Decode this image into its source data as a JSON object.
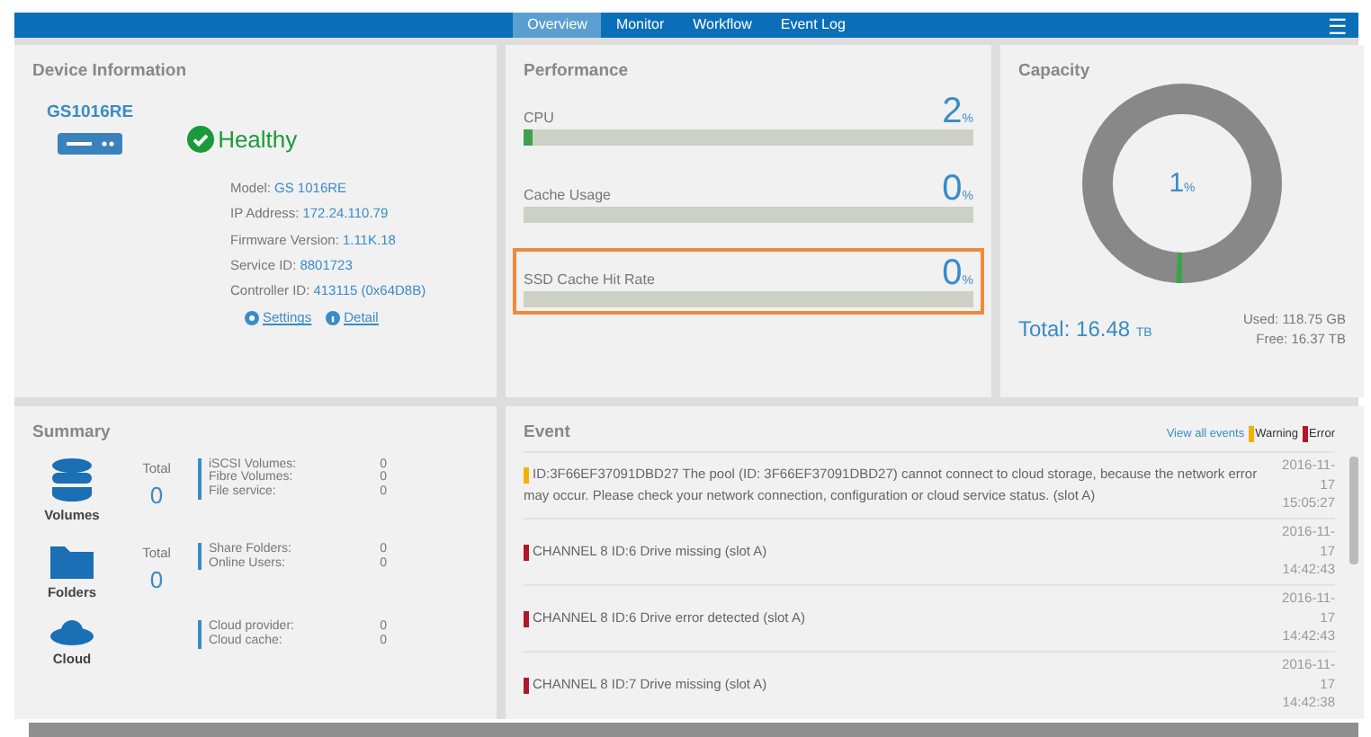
{
  "nav": {
    "tabs": [
      {
        "label": "Overview",
        "selected": true
      },
      {
        "label": "Monitor",
        "selected": false
      },
      {
        "label": "Workflow",
        "selected": false
      },
      {
        "label": "Event Log",
        "selected": false
      }
    ],
    "menu_icon": "☰"
  },
  "device": {
    "title": "Device Information",
    "name": "GS1016RE",
    "status": "Healthy",
    "healthy": true,
    "fields": [
      {
        "label": "Model:",
        "value": "GS 1016RE"
      },
      {
        "label": "IP Address:",
        "value": "172.24.110.79"
      },
      {
        "label": "Firmware Version:",
        "value": "1.11K.18"
      },
      {
        "label": "Service ID:",
        "value": "8801723"
      },
      {
        "label": "Controller ID:",
        "value": "413115 (0x64D8B)"
      }
    ],
    "links": [
      {
        "label": "Settings",
        "kind": "settings"
      },
      {
        "label": "Detail",
        "kind": "info"
      }
    ]
  },
  "performance": {
    "title": "Performance",
    "metrics": [
      {
        "label": "CPU",
        "value": "2",
        "unit": "%",
        "level": 0.02,
        "highlighted": false
      },
      {
        "label": "Cache Usage",
        "value": "0",
        "unit": "%",
        "level": 0,
        "highlighted": false
      },
      {
        "label": "SSD Cache Hit Rate",
        "value": "0",
        "unit": "%",
        "level": 0,
        "highlighted": true
      }
    ]
  },
  "capacity": {
    "title": "Capacity",
    "value": "1",
    "unit": "%",
    "level": 0.01,
    "total_label": "Total:",
    "total": "16.48",
    "total_unit": "TB",
    "used": "Used: 118.75 GB",
    "free": "Free: 16.37 TB"
  },
  "summary": {
    "title": "Summary",
    "groups": [
      {
        "kind": "volumes",
        "name": "Volumes",
        "total_label": "Total",
        "total": "0",
        "items": [
          {
            "label": "iSCSI Volumes:",
            "value": "0"
          },
          {
            "label": "Fibre Volumes:",
            "value": "0"
          },
          {
            "label": "File service:",
            "value": "0"
          }
        ]
      },
      {
        "kind": "folders",
        "name": "Folders",
        "total_label": "Total",
        "total": "0",
        "items": [
          {
            "label": "Share Folders:",
            "value": "0"
          },
          {
            "label": "Online Users:",
            "value": "0"
          }
        ]
      },
      {
        "kind": "cloud",
        "name": "Cloud",
        "items": [
          {
            "label": "Cloud provider:",
            "value": "0"
          },
          {
            "label": "Cloud cache:",
            "value": "0"
          }
        ]
      }
    ]
  },
  "event": {
    "title": "Event",
    "view_all": "View all events",
    "legend": [
      {
        "label": "Warning",
        "color": "#f0b400"
      },
      {
        "label": "Error",
        "color": "#b0182a"
      }
    ],
    "rows": [
      {
        "color": "#f0b400",
        "text": "ID:3F66EF37091DBD27 The pool (ID: 3F66EF37091DBD27) cannot connect to cloud storage, because the network error may occur. Please check your network connection, configuration or cloud service status. (slot A)",
        "date": "2016-11-17",
        "time": "15:05:27"
      },
      {
        "color": "#b0182a",
        "text": "CHANNEL 8 ID:6 Drive missing (slot A)",
        "date": "2016-11-17",
        "time": "14:42:43"
      },
      {
        "color": "#b0182a",
        "text": "CHANNEL 8 ID:6 Drive error detected (slot A)",
        "date": "2016-11-17",
        "time": "14:42:43"
      },
      {
        "color": "#b0182a",
        "text": "CHANNEL 8 ID:7 Drive missing (slot A)",
        "date": "2016-11-17",
        "time": "14:42:38"
      }
    ]
  }
}
